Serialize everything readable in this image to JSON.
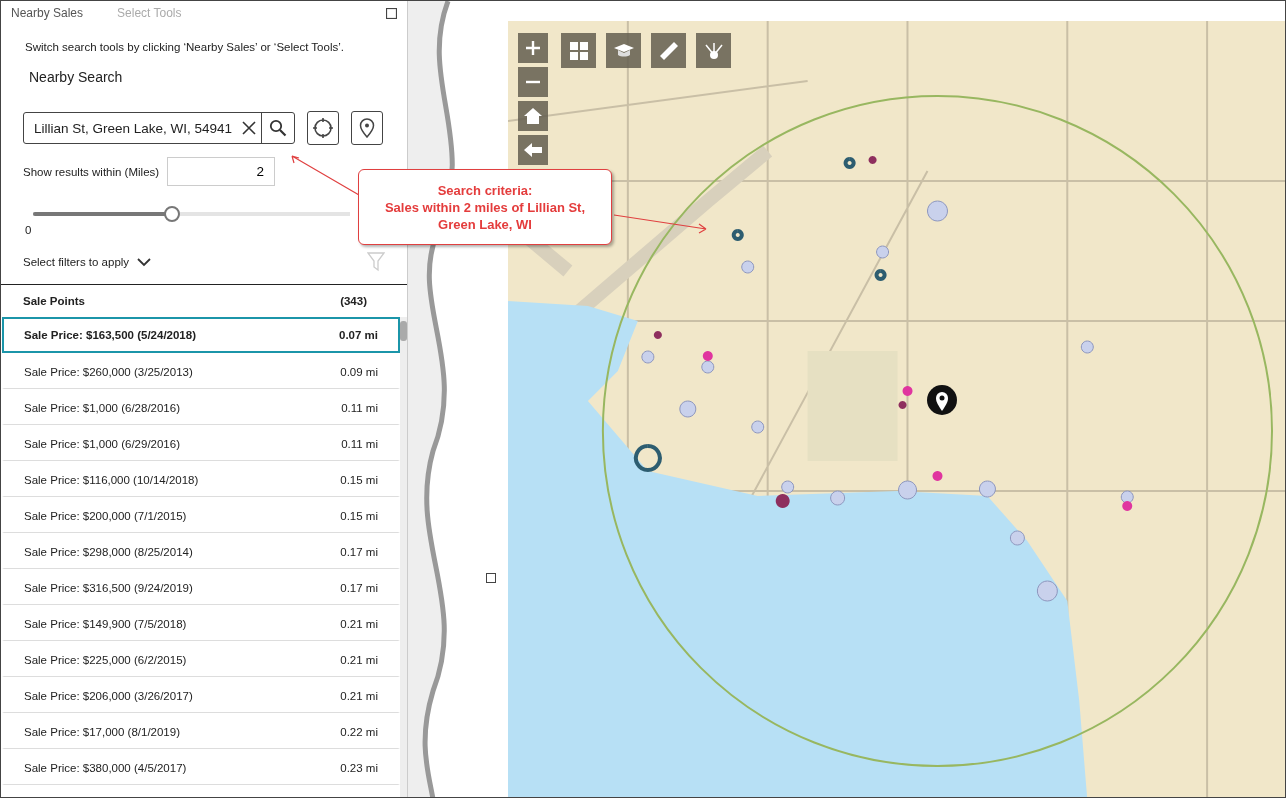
{
  "tabs": [
    {
      "label": "Nearby Sales",
      "selected": true
    },
    {
      "label": "Select Tools",
      "selected": false
    }
  ],
  "instructions": "Switch search tools by clicking ‘Nearby Sales’ or ‘Select Tools’.",
  "section_title": "Nearby Search",
  "search": {
    "value": "Lillian St, Green Lake, WI, 54941"
  },
  "distance": {
    "label": "Show results within (Miles)",
    "value": "2",
    "level": 0.44,
    "min_label": "0"
  },
  "filters": {
    "label": "Select filters to apply",
    "expanded": false
  },
  "results": {
    "title": "Sale Points",
    "count": "(343)",
    "rows": [
      {
        "label": "Sale Price: $163,500 (5/24/2018)",
        "distance": "0.07 mi",
        "selected": true
      },
      {
        "label": "Sale Price: $260,000 (3/25/2013)",
        "distance": "0.09 mi",
        "selected": false
      },
      {
        "label": "Sale Price: $1,000 (6/28/2016)",
        "distance": "0.11 mi",
        "selected": false
      },
      {
        "label": "Sale Price: $1,000 (6/29/2016)",
        "distance": "0.11 mi",
        "selected": false
      },
      {
        "label": "Sale Price: $116,000 (10/14/2018)",
        "distance": "0.15 mi",
        "selected": false
      },
      {
        "label": "Sale Price: $200,000 (7/1/2015)",
        "distance": "0.15 mi",
        "selected": false
      },
      {
        "label": "Sale Price: $298,000 (8/25/2014)",
        "distance": "0.17 mi",
        "selected": false
      },
      {
        "label": "Sale Price: $316,500 (9/24/2019)",
        "distance": "0.17 mi",
        "selected": false
      },
      {
        "label": "Sale Price: $149,900 (7/5/2018)",
        "distance": "0.21 mi",
        "selected": false
      },
      {
        "label": "Sale Price: $225,000 (6/2/2015)",
        "distance": "0.21 mi",
        "selected": false
      },
      {
        "label": "Sale Price: $206,000 (3/26/2017)",
        "distance": "0.21 mi",
        "selected": false
      },
      {
        "label": "Sale Price: $17,000 (8/1/2019)",
        "distance": "0.22 mi",
        "selected": false
      },
      {
        "label": "Sale Price: $380,000 (4/5/2017)",
        "distance": "0.23 mi",
        "selected": false
      }
    ]
  },
  "callout": {
    "title": "Search criteria:",
    "text": "Sales within 2 miles of Lillian St, Green Lake, WI"
  }
}
